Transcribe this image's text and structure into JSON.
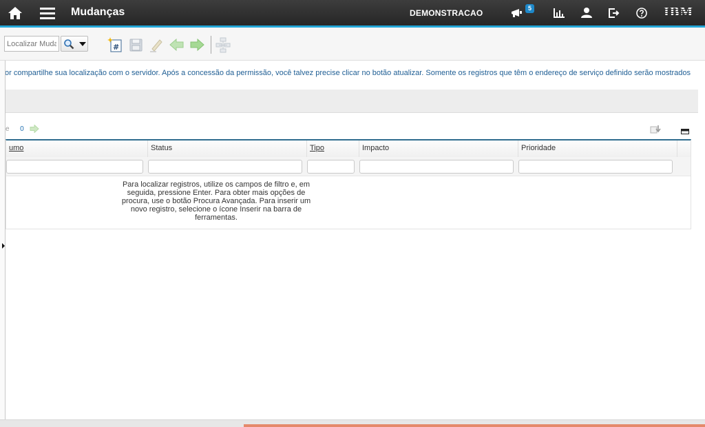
{
  "header": {
    "app_title": "Mudanças",
    "user_name": "DEMONSTRACAO",
    "notifications_count": "5",
    "brand_logo_text": "IBM",
    "icons": [
      "home-icon",
      "menu-icon",
      "bulletin-icon",
      "reports-icon",
      "profile-icon",
      "sign-out-icon",
      "help-icon"
    ]
  },
  "toolbar": {
    "search_placeholder": "Localizar Muda",
    "tools": [
      "new-record-icon",
      "save-icon",
      "clear-changes-icon",
      "previous-record-icon",
      "next-record-icon",
      "workflow-icon"
    ]
  },
  "location_message": "or compartilhe sua localização com o servidor. Após a concessão da permissão, você talvez precise clicar no botão atualizar. Somente os registros que têm o endereço de serviço definido serão mostrados",
  "pager": {
    "label": "e",
    "count": "0"
  },
  "table": {
    "columns": [
      {
        "label": "umo",
        "sortable": true
      },
      {
        "label": "Status",
        "sortable": false
      },
      {
        "label": "Tipo",
        "sortable": true
      },
      {
        "label": "Impacto",
        "sortable": false
      },
      {
        "label": "Prioridade",
        "sortable": false
      }
    ],
    "empty_message": "Para localizar registros, utilize os campos de filtro e, em seguida, pressione Enter. Para obter mais opções de procura, use o botão Procura Avançada. Para inserir um novo registro, selecione o ícone Inserir na barra de ferramentas."
  },
  "colors": {
    "topbar": "#2b2b2b",
    "accent": "#23a6d7",
    "message_text": "#1f5e94",
    "progress": "#e5896b"
  }
}
